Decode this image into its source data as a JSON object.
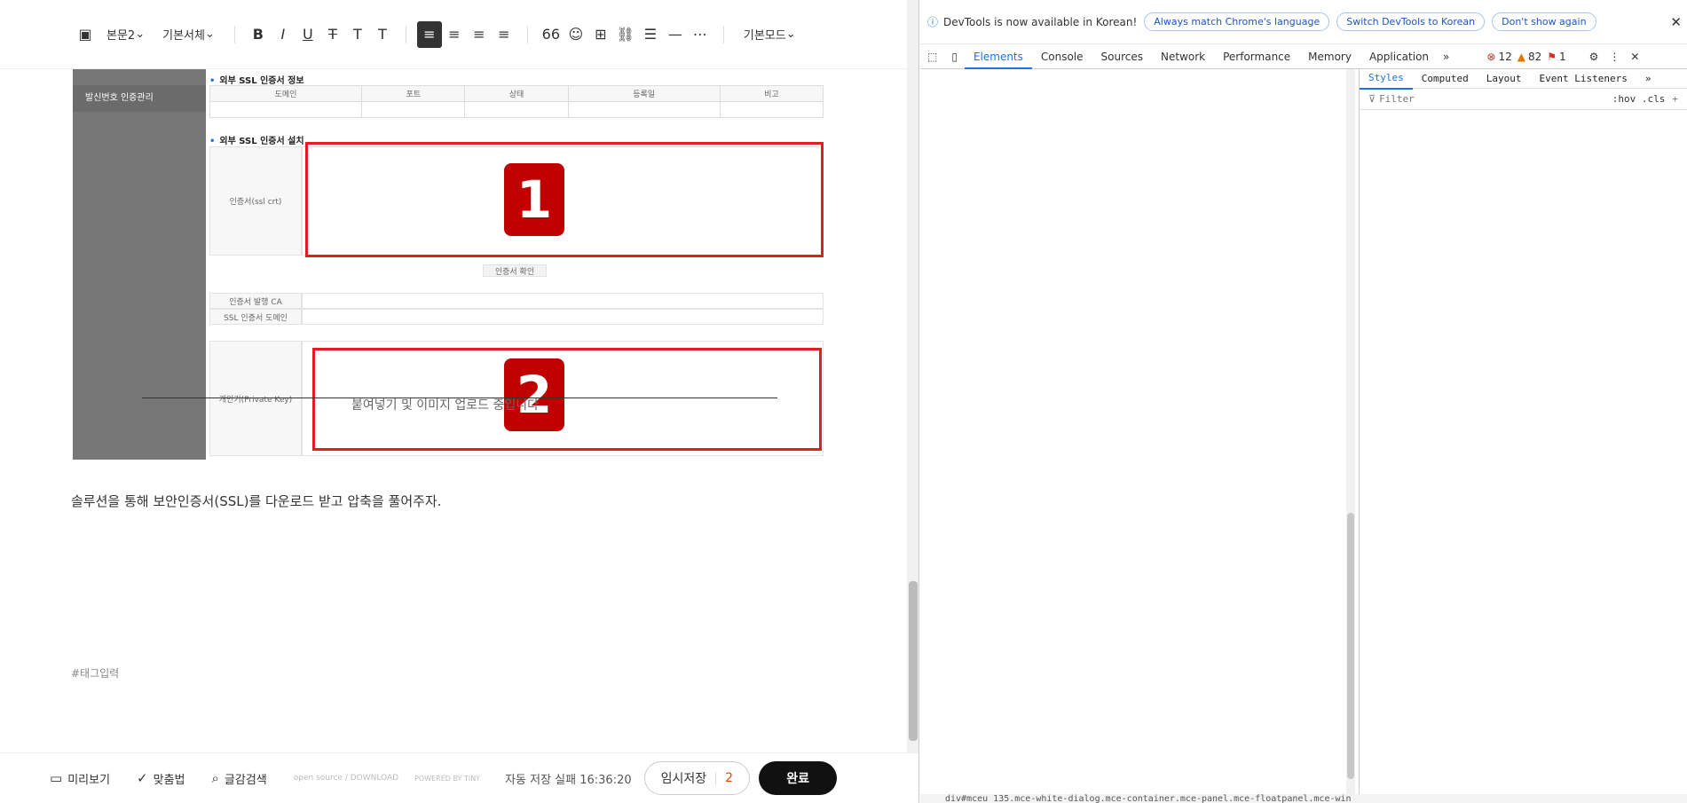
{
  "editor": {
    "toolbar": {
      "image": "▣",
      "font_style": "본문2",
      "font_family": "기본서체",
      "bold": "B",
      "italic": "I",
      "underline": "U",
      "strike": "T",
      "color": "T",
      "bg": "T",
      "align_left": "≡",
      "align_center": "≡",
      "align_right": "≡",
      "align_justify": "≡",
      "quote": "66",
      "emoji": "☺",
      "table": "⊞",
      "link": "⛓",
      "list": "☰",
      "hr": "—",
      "more": "⋯",
      "mode": "기본모드"
    },
    "doc": {
      "side_item": "발신번호 인증관리",
      "section1": "외부 SSL 인증서 정보",
      "table_headers": [
        "도메인",
        "포트",
        "상태",
        "등록일",
        "비고"
      ],
      "section2": "외부 SSL 인증서 설치",
      "cert_label": "인증서(ssl crt)",
      "confirm_btn": "인증서 확인",
      "ca_label": "인증서 발행 CA",
      "domain_label": "SSL 인증서 도메인",
      "key_label": "개인키(Private Key)",
      "paste_hint": "붙여넣기 및 이미지 업로드 중입니다",
      "badge1": "1",
      "badge2": "2"
    },
    "body_text": "솔루션을 통해 보안인증서(SSL)를 다운로드 받고 압축을 풀어주자.",
    "tag_placeholder": "#태그입력",
    "bottom": {
      "preview": "미리보기",
      "spell": "맞춤법",
      "search": "글감검색",
      "opensource": "open source / DOWNLOAD",
      "powered": "POWERED BY TINY",
      "autosave": "자동 저장 실패 16:36:20",
      "temp_save": "임시저장",
      "temp_count": "2",
      "done": "완료"
    }
  },
  "devtools": {
    "info": "DevTools is now available in Korean!",
    "btn1": "Always match Chrome's language",
    "btn2": "Switch DevTools to Korean",
    "btn3": "Don't show again",
    "tabs": [
      "Elements",
      "Console",
      "Sources",
      "Network",
      "Performance",
      "Memory",
      "Application"
    ],
    "errors": "12",
    "warnings": "82",
    "issues": "1",
    "style_tabs": [
      "Styles",
      "Computed",
      "Layout",
      "Event Listeners"
    ],
    "filter": "Filter",
    "filter_tools": ":hov .cls",
    "crumb": "div#mceu_135.mce-white-dialog.mce-container.mce-panel.mce-floatpanel.mce-win"
  }
}
